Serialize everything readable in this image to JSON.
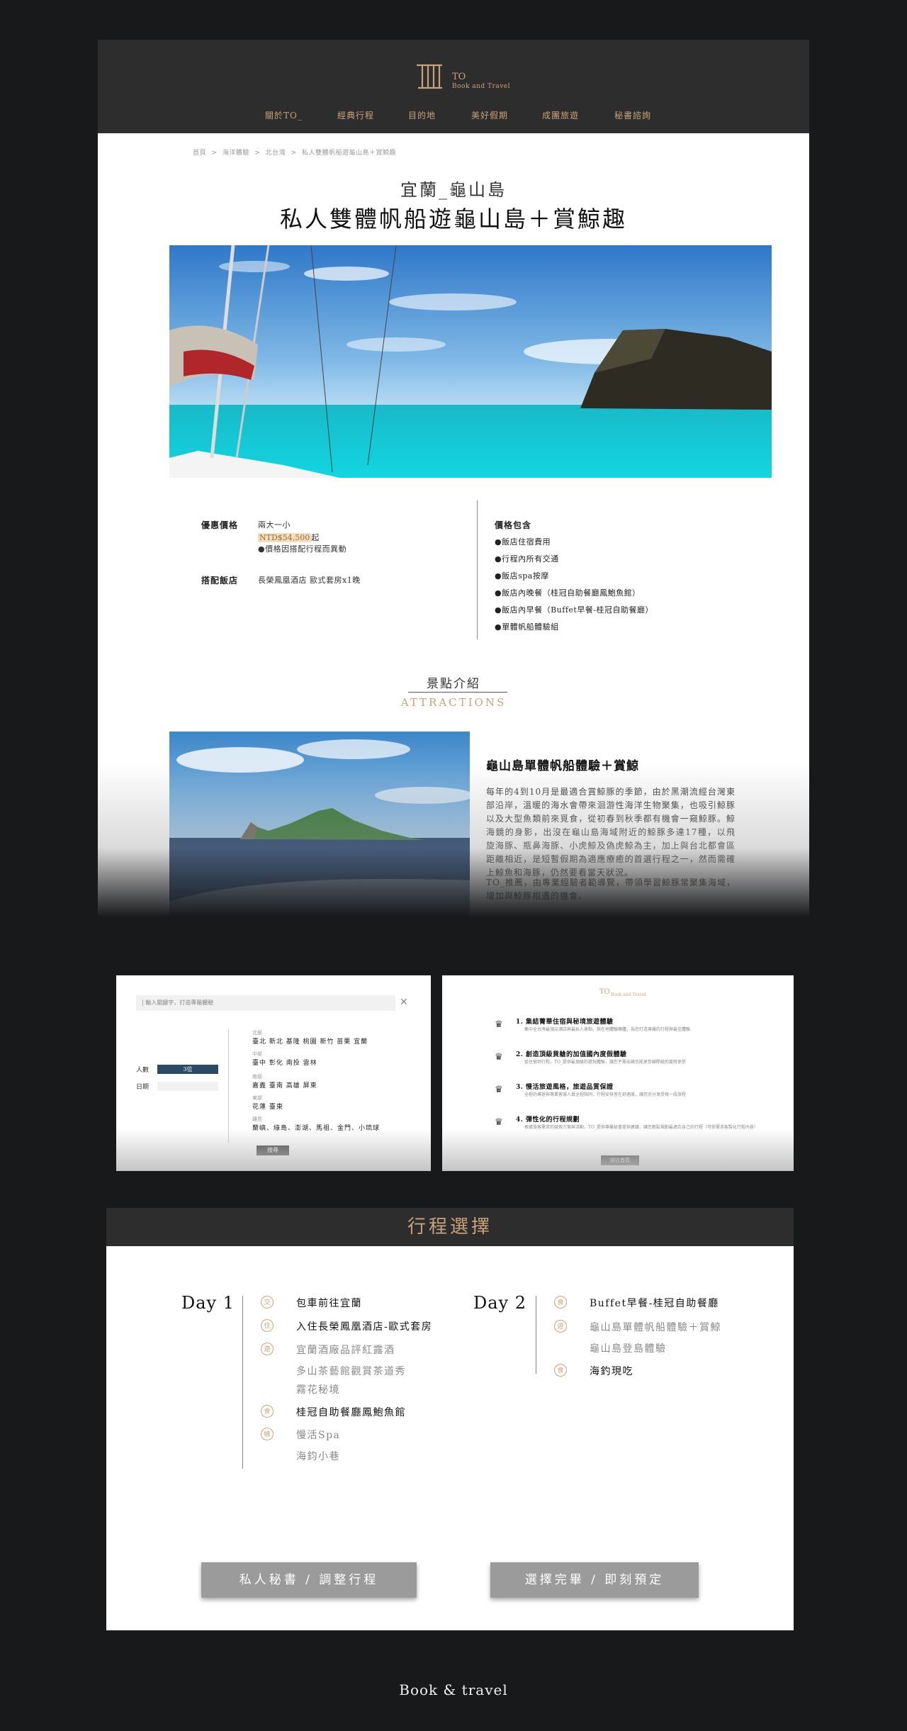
{
  "brand": {
    "mark": "TO",
    "name": "TO",
    "tagline": "Book and Travel"
  },
  "nav": [
    "關於TO_",
    "經典行程",
    "目的地",
    "美好假期",
    "成團旅遊",
    "秘書諮詢"
  ],
  "breadcrumb": [
    "首頁",
    ">",
    "海洋體驗",
    ">",
    "北台灣",
    ">",
    "私人雙體帆船遊龜山島＋賞鯨趣"
  ],
  "tour": {
    "location": "宜蘭_龜山島",
    "title": "私人雙體帆船遊龜山島＋賞鯨趣",
    "price_label": "優惠價格",
    "price_basis": "兩大一小",
    "price_value": "NTD$54,500",
    "price_suffix": "起",
    "price_note": "●價格因搭配行程而異動",
    "hotel_label": "搭配飯店",
    "hotel_value": "長榮鳳凰酒店 歐式套房x1晚",
    "includes_label": "價格包含",
    "includes": [
      "●飯店住宿費用",
      "●行程內所有交通",
      "●飯店spa按摩",
      "●飯店內晚餐（桂冠自助餐廳鳳鮑魚館）",
      "●飯店內早餐（Buffet早餐-桂冠自助餐廳）",
      "●單體帆船體驗組"
    ]
  },
  "attractions": {
    "title_cn": "景點介紹",
    "title_en": "ATTRACTIONS",
    "item_title": "龜山島單體帆船體驗＋賞鯨",
    "paragraph1": "每年的4到10月是最適合賞鯨豚的季節，由於黑潮流經台灣東部沿岸，溫暖的海水會帶來洄游性海洋生物聚集，也吸引鯨豚以及大型魚類前來覓食，從初春到秋季都有機會一窺鯨豚。鯨海鏡的身影，出沒在龜山島海域附近的鯨豚多達17種，以飛旋海豚、瓶鼻海豚、小虎鯨及偽虎鯨為主，加上與台北都會區距離相近，是短暫假期為適應療癒的首選行程之一，然而需確上鯨魚和海豚，仍然要看當天狀況。",
    "paragraph2": "TO_推薦，由專業經驗者範導覽，帶領學習鯨豚常聚集海域，增加與鯨豚相遇的機會。"
  },
  "search_panel": {
    "placeholder": "| 輸入關鍵字，打造專屬體驗",
    "close": "✕",
    "people_label": "人數",
    "people_value": "3位",
    "date_label": "日期",
    "regions": [
      {
        "name": "北部",
        "cities": "臺北  新北  基隆  桃園  新竹  苗栗  宜蘭"
      },
      {
        "name": "中部",
        "cities": "臺中  彰化  南投  雲林"
      },
      {
        "name": "南部",
        "cities": "嘉義  臺南  高雄  屏東"
      },
      {
        "name": "東部",
        "cities": "花蓮  臺東"
      },
      {
        "name": "離島",
        "cities": "蘭嶼、綠島、澎湖、馬祖、金門、小琉球"
      }
    ],
    "search_button": "搜尋"
  },
  "features_panel": {
    "logo": "TO",
    "logo_sub": "Book and Travel",
    "items": [
      {
        "title": "1. 集結菁華住宿與秘境旅遊體驗",
        "desc": "集中全台灣最頂尖酒店與最私人景點，與在地體驗團體，為您打造專屬的行程與最佳體驗"
      },
      {
        "title": "2. 創造頂級貨艙的加值國內度假體驗",
        "desc": "從住宿到行程，TO_提供最頂級的遊玩體驗，讓您不需出國也能享受國際級的度假享受"
      },
      {
        "title": "3. 慢活旅遊風格，旅遊品質保證",
        "desc": "全程的導遊與專業客服人員全程陪同，行程安排皆在舒適度，讓您充分享受每一段旅程"
      },
      {
        "title": "4. 彈性化的行程規劃",
        "desc": "根據旅客需求的度假方案與活動，TO_提供專屬秘書提供建議，讓您輕鬆規劃最適合自己的行程（可依需求客製化行程內容）"
      }
    ],
    "button": "前往首頁"
  },
  "itinerary": {
    "heading": "行程選擇",
    "day1_label": "Day 1",
    "day2_label": "Day 2",
    "day1": [
      {
        "icon": "交",
        "text": "包車前往宜蘭",
        "tone": "dark"
      },
      {
        "icon": "住",
        "text": "入住長榮鳳凰酒店-歐式套房",
        "tone": "dark"
      },
      {
        "icon": "遊",
        "text": "宜蘭酒廠品評紅露酒",
        "tone": "grey"
      },
      {
        "icon": "",
        "text": "多山茶藝館觀賞茶道秀",
        "tone": "grey"
      },
      {
        "icon": "",
        "text": "霧花秘境",
        "tone": "grey"
      },
      {
        "icon": "食",
        "text": "桂冠自助餐廳鳳鮑魚館",
        "tone": "dark"
      },
      {
        "icon": "嬉",
        "text": "慢活Spa",
        "tone": "grey"
      },
      {
        "icon": "",
        "text": "海鈞小巷",
        "tone": "grey"
      }
    ],
    "day2": [
      {
        "icon": "食",
        "text": "Buffet早餐-桂冠自助餐廳",
        "tone": "dark"
      },
      {
        "icon": "遊",
        "text": "龜山島單體帆船體驗＋賞鯨",
        "tone": "grey"
      },
      {
        "icon": "",
        "text": "龜山島登島體驗",
        "tone": "grey"
      },
      {
        "icon": "食",
        "text": "海釣現吃",
        "tone": "dark"
      }
    ],
    "btn_secretary": "私人秘書 / 調整行程",
    "btn_book": "選擇完畢 / 即刻預定"
  },
  "footer": "Book & travel"
}
